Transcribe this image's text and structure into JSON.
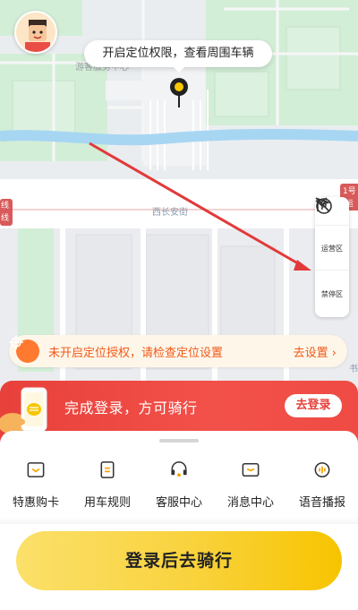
{
  "map": {
    "location_tip": "开启定位权限，查看周围车辆",
    "poi_label": "游客服务中心",
    "street_label": "西长安街",
    "left_edge_label_1": "线",
    "left_edge_label_2": "线",
    "right_edge_label_1": "1号",
    "right_edge_label_2": "运",
    "right_edge_label_3": "书"
  },
  "side_panel": {
    "operating_zone": "运营区",
    "no_parking_zone": "禁停区"
  },
  "notice": {
    "text": "未开启定位授权，请检查定位设置",
    "link": "去设置 ›"
  },
  "login_banner": {
    "text": "完成登录，方可骑行",
    "button": "去登录"
  },
  "menu": {
    "items": [
      {
        "label": "特惠购卡"
      },
      {
        "label": "用车规则"
      },
      {
        "label": "客服中心"
      },
      {
        "label": "消息中心"
      },
      {
        "label": "语音播报"
      }
    ]
  },
  "cta": {
    "label": "登录后去骑行"
  },
  "colors": {
    "accent_red": "#e8403a",
    "accent_yellow": "#f9d23c",
    "icon_orange": "#f5a300",
    "notice_orange": "#f05a18"
  }
}
